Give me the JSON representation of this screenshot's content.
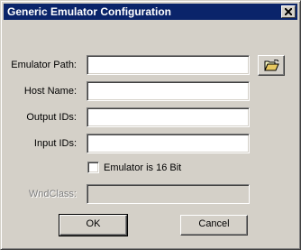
{
  "window": {
    "title": "Generic Emulator Configuration",
    "close_icon": "close-icon"
  },
  "form": {
    "emulator_path": {
      "label": "Emulator Path:",
      "value": ""
    },
    "host_name": {
      "label": "Host Name:",
      "value": ""
    },
    "output_ids": {
      "label": "Output IDs:",
      "value": ""
    },
    "input_ids": {
      "label": "Input IDs:",
      "value": ""
    },
    "emulator_16bit": {
      "label": "Emulator is 16 Bit",
      "checked": false
    },
    "wndclass": {
      "label": "WndClass:",
      "value": "",
      "disabled": true
    },
    "browse_icon": "folder-open-icon"
  },
  "buttons": {
    "ok": "OK",
    "cancel": "Cancel"
  },
  "colors": {
    "titlebar": "#0a246a",
    "face": "#d4d0c8"
  }
}
